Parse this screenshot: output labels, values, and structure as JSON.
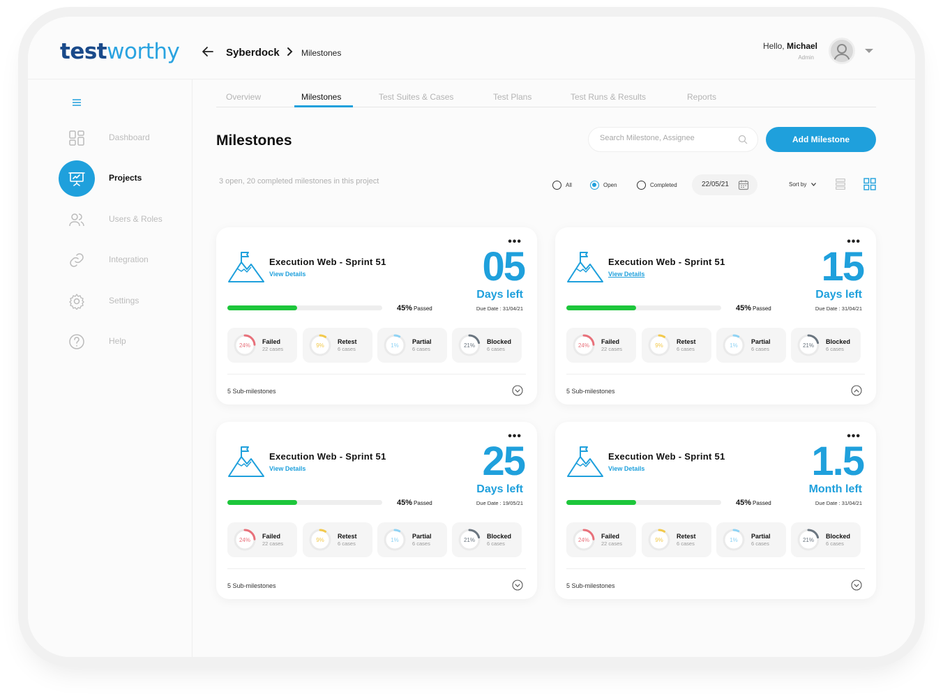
{
  "app": {
    "logo_part1": "test",
    "logo_part2": "worthy"
  },
  "header": {
    "project": "Syberdock",
    "current": "Milestones",
    "greeting": "Hello,",
    "user_name": "Michael",
    "user_role": "Admin"
  },
  "sidebar": {
    "items": [
      {
        "label": "Dashboard",
        "icon": "dashboard-icon"
      },
      {
        "label": "Projects",
        "icon": "presentation-icon",
        "active": true
      },
      {
        "label": "Users & Roles",
        "icon": "users-icon"
      },
      {
        "label": "Integration",
        "icon": "link-icon"
      },
      {
        "label": "Settings",
        "icon": "gear-icon"
      },
      {
        "label": "Help",
        "icon": "help-icon"
      }
    ]
  },
  "tabs": [
    {
      "label": "Overview"
    },
    {
      "label": "Milestones",
      "active": true
    },
    {
      "label": "Test Suites & Cases"
    },
    {
      "label": "Test Plans"
    },
    {
      "label": "Test Runs & Results"
    },
    {
      "label": "Reports"
    }
  ],
  "page": {
    "title": "Milestones",
    "search_placeholder": "Search Milestone, Assignee",
    "add_button": "Add Milestone",
    "summary": "3 open, 20 completed milestones in this project",
    "filters": {
      "all": "All",
      "open": "Open",
      "completed": "Completed",
      "selected": "Open"
    },
    "date": "22/05/21",
    "sort_label": "Sort by"
  },
  "colors": {
    "accent": "#1fa0dc",
    "progress": "#1dc63b",
    "failed": "#e8707a",
    "retest": "#f2c94c",
    "partial": "#8fd3f4",
    "blocked": "#6b7680"
  },
  "cards": [
    {
      "name": "Execution Web - Sprint 51",
      "view": "View Details",
      "count": "05",
      "unit": "Days left",
      "due": "Due Date : 31/04/21",
      "progress": 0.45,
      "passed_pct": "45%",
      "passed_label": "Passed",
      "stats": [
        {
          "pct": "24%",
          "name": "Failed",
          "cases": "22 cases",
          "value": 0.24
        },
        {
          "pct": "9%",
          "name": "Retest",
          "cases": "6 cases",
          "value": 0.09
        },
        {
          "pct": "1%",
          "name": "Partial",
          "cases": "6 cases",
          "value": 0.01
        },
        {
          "pct": "21%",
          "name": "Blocked",
          "cases": "6 cases",
          "value": 0.21
        }
      ],
      "sub": "5 Sub-milestones",
      "expanded": false
    },
    {
      "name": "Execution Web - Sprint 51",
      "view": "View Details",
      "count": "15",
      "unit": "Days left",
      "due": "Due Date : 31/04/21",
      "progress": 0.45,
      "passed_pct": "45%",
      "passed_label": "Passed",
      "stats": [
        {
          "pct": "24%",
          "name": "Failed",
          "cases": "22 cases",
          "value": 0.24
        },
        {
          "pct": "9%",
          "name": "Retest",
          "cases": "6 cases",
          "value": 0.09
        },
        {
          "pct": "1%",
          "name": "Partial",
          "cases": "6 cases",
          "value": 0.01
        },
        {
          "pct": "21%",
          "name": "Blocked",
          "cases": "6 cases",
          "value": 0.21
        }
      ],
      "sub": "5 Sub-milestones",
      "expanded": true
    },
    {
      "name": "Execution Web - Sprint 51",
      "view": "View Details",
      "count": "25",
      "unit": "Days left",
      "due": "Due Date : 19/05/21",
      "progress": 0.45,
      "passed_pct": "45%",
      "passed_label": "Passed",
      "stats": [
        {
          "pct": "24%",
          "name": "Failed",
          "cases": "22 cases",
          "value": 0.24
        },
        {
          "pct": "9%",
          "name": "Retest",
          "cases": "6 cases",
          "value": 0.09
        },
        {
          "pct": "1%",
          "name": "Partial",
          "cases": "6 cases",
          "value": 0.01
        },
        {
          "pct": "21%",
          "name": "Blocked",
          "cases": "6 cases",
          "value": 0.21
        }
      ],
      "sub": "5 Sub-milestones",
      "expanded": false
    },
    {
      "name": "Execution Web - Sprint 51",
      "view": "View Details",
      "count": "1.5",
      "unit": "Month left",
      "due": "Due Date : 31/04/21",
      "progress": 0.45,
      "passed_pct": "45%",
      "passed_label": "Passed",
      "stats": [
        {
          "pct": "24%",
          "name": "Failed",
          "cases": "22 cases",
          "value": 0.24
        },
        {
          "pct": "9%",
          "name": "Retest",
          "cases": "6 cases",
          "value": 0.09
        },
        {
          "pct": "1%",
          "name": "Partial",
          "cases": "6 cases",
          "value": 0.01
        },
        {
          "pct": "21%",
          "name": "Blocked",
          "cases": "6 cases",
          "value": 0.21
        }
      ],
      "sub": "5 Sub-milestones",
      "expanded": false
    }
  ]
}
